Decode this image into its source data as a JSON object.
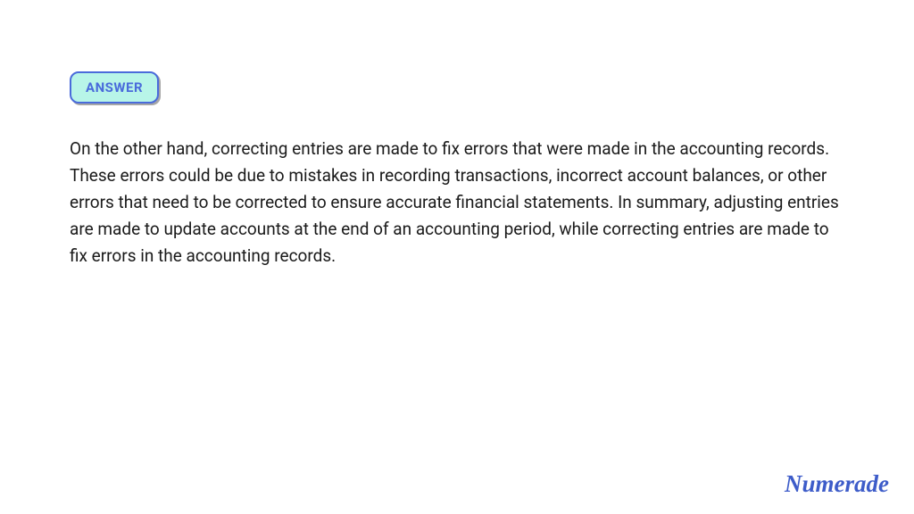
{
  "badge": {
    "label": "ANSWER"
  },
  "answer": {
    "body": "On the other hand, correcting entries are made to fix errors that were made in the accounting records. These errors could be due to mistakes in recording transactions, incorrect account balances, or other errors that need to be corrected to ensure accurate financial statements. In summary, adjusting entries are made to update accounts at the end of an accounting period, while correcting entries are made to fix errors in the accounting records."
  },
  "brand": {
    "name": "Numerade"
  }
}
